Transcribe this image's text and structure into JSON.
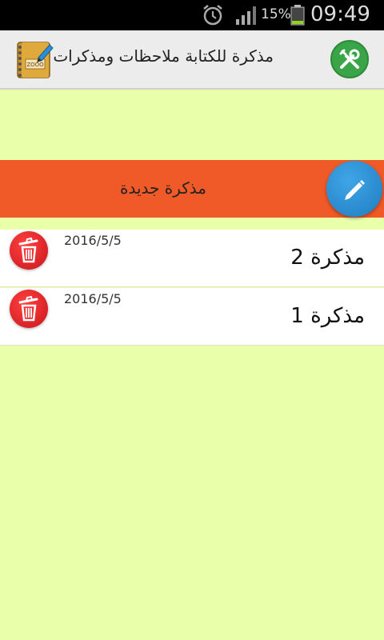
{
  "status_bar": {
    "battery_percent": "15%",
    "time": "09:49",
    "icons": [
      "alarm-icon",
      "signal-icon",
      "battery-icon"
    ]
  },
  "app_bar": {
    "title": "مذكرة للكتابة ملاحظات ومذكرات",
    "app_icon": "notebook-pen-icon",
    "app_icon_text": "ZOOO",
    "settings_icon": "tools-icon"
  },
  "new_note": {
    "label": "مذكرة جديدة",
    "button_icon": "pencil-icon"
  },
  "notes": [
    {
      "title": "مذكرة 2",
      "date": "2016/5/5"
    },
    {
      "title": "مذكرة 1",
      "date": "2016/5/5"
    }
  ],
  "colors": {
    "background": "#eaffaa",
    "new_note_bar": "#f05a28",
    "edit_button": "#2a8fd6",
    "delete_button": "#e32228",
    "settings_button": "#3aa548"
  }
}
